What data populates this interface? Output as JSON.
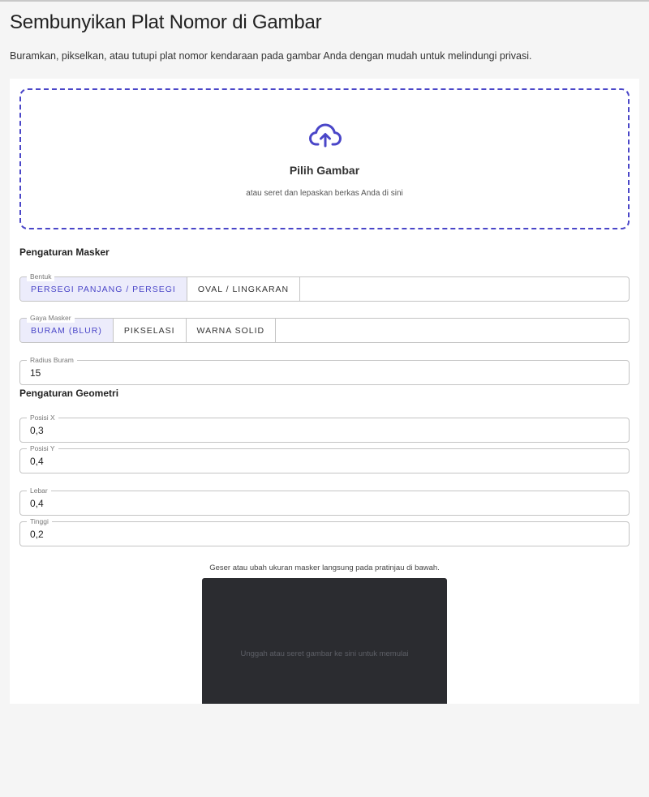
{
  "header": {
    "title": "Sembunyikan Plat Nomor di Gambar",
    "description": "Buramkan, pikselkan, atau tutupi plat nomor kendaraan pada gambar Anda dengan mudah untuk melindungi privasi."
  },
  "upload": {
    "icon": "cloud-upload-icon",
    "button_label": "Pilih Gambar",
    "hint": "atau seret dan lepaskan berkas Anda di sini"
  },
  "mask_settings": {
    "heading": "Pengaturan Masker",
    "shape": {
      "legend": "Bentuk",
      "options": [
        "PERSEGI PANJANG / PERSEGI",
        "OVAL / LINGKARAN"
      ],
      "selected": "PERSEGI PANJANG / PERSEGI"
    },
    "style": {
      "legend": "Gaya Masker",
      "options": [
        "BURAM (BLUR)",
        "PIKSELASI",
        "WARNA SOLID"
      ],
      "selected": "BURAM (BLUR)"
    },
    "blur_radius": {
      "legend": "Radius Buram",
      "value": "15"
    }
  },
  "geometry_settings": {
    "heading": "Pengaturan Geometri",
    "pos_x": {
      "legend": "Posisi X",
      "value": "0,3"
    },
    "pos_y": {
      "legend": "Posisi Y",
      "value": "0,4"
    },
    "width": {
      "legend": "Lebar",
      "value": "0,4"
    },
    "height": {
      "legend": "Tinggi",
      "value": "0,2"
    }
  },
  "preview": {
    "hint": "Geser atau ubah ukuran masker langsung pada pratinjau di bawah.",
    "placeholder": "Unggah atau seret gambar ke sini untuk memulai"
  },
  "colors": {
    "accent": "#4a46c8",
    "accent_bg": "#ececfb",
    "preview_bg": "#2b2c30",
    "page_bg": "#f5f5f5"
  }
}
